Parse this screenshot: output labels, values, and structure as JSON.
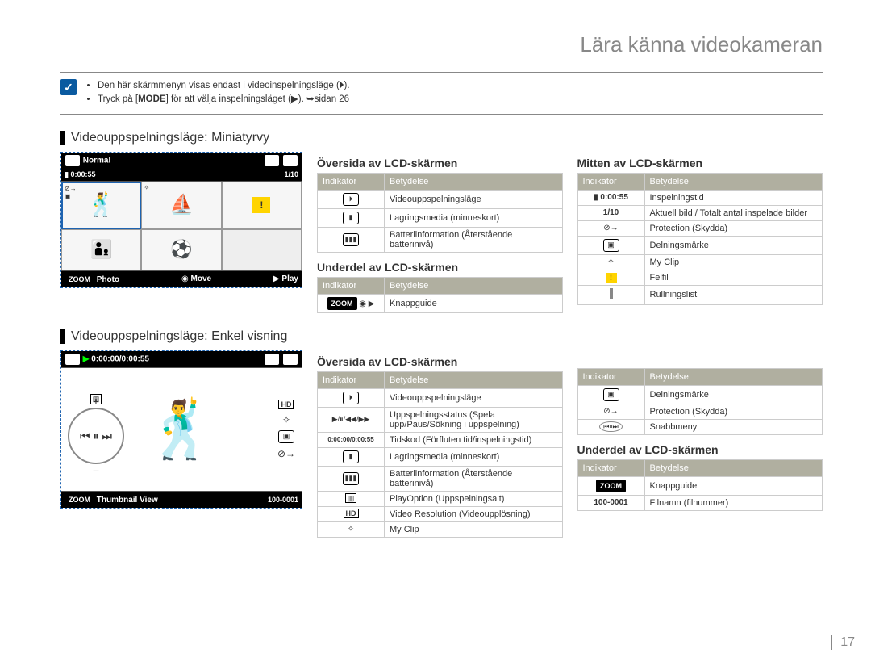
{
  "page": {
    "title": "Lära känna videokameran",
    "number": "17"
  },
  "notes": {
    "bullet1": "Den här skärmmenyn visas endast i videoinspelningsläge (⏵).",
    "bullet2_a": "Tryck på [",
    "bullet2_mode": "MODE",
    "bullet2_b": "] för att välja inspelningsläget (▶). ➥sidan 26"
  },
  "sections": {
    "s1": "Videouppspelningsläge: Miniatyrvy",
    "s2": "Videouppspelningsläge: Enkel visning"
  },
  "lcd1": {
    "topLeft": "Normal",
    "subLeft": "0:00:55",
    "subRight": "1/10",
    "botPhoto": "Photo",
    "botMove": "Move",
    "botPlay": "Play",
    "zoom": "ZOOM"
  },
  "lcd2": {
    "play": "▶",
    "time": "0:00:00/0:00:55",
    "bottomLeft": "Thumbnail View",
    "bottomRight": "100-0001",
    "zoom": "ZOOM"
  },
  "headers": {
    "top": "Översida av LCD-skärmen",
    "mid": "Mitten av LCD-skärmen",
    "bottom": "Underdel av LCD-skärmen",
    "ind": "Indikator",
    "mean": "Betydelse"
  },
  "table_top1": [
    {
      "i": "⏵",
      "m": "Videouppspelningsläge"
    },
    {
      "i": "▮",
      "m": "Lagringsmedia (minneskort)"
    },
    {
      "i": "▮▮▮",
      "m": "Batteriinformation (Återstående batterinivå)"
    }
  ],
  "table_bottom1": [
    {
      "i": "ZOOM ◉ ▶",
      "m": "Knappguide"
    }
  ],
  "table_mid1": [
    {
      "i": "▮ 0:00:55",
      "m": "Inspelningstid"
    },
    {
      "i": "1/10",
      "m": "Aktuell bild / Totalt antal inspelade bilder"
    },
    {
      "i": "⊘→",
      "m": "Protection (Skydda)"
    },
    {
      "i": "▣",
      "m": "Delningsmärke"
    },
    {
      "i": "✧",
      "m": "My Clip"
    },
    {
      "i": "⚠",
      "m": "Felfil"
    },
    {
      "i": "",
      "m": "Rullningslist"
    }
  ],
  "table_top2": [
    {
      "i": "⏵",
      "m": "Videouppspelningsläge"
    },
    {
      "i": "▶/⏸/◀◀/▶▶",
      "m": "Uppspelningsstatus (Spela upp/Paus/Sökning i uppspelning)"
    },
    {
      "i": "0:00:00/0:00:55",
      "m": "Tidskod (Förfluten tid/inspelningstid)"
    },
    {
      "i": "▮",
      "m": "Lagringsmedia (minneskort)"
    },
    {
      "i": "▮▮▮",
      "m": "Batteriinformation (Återstående batterinivå)"
    },
    {
      "i": "▥",
      "m": "PlayOption (Uppspelningsalt)"
    },
    {
      "i": "HD",
      "m": "Video Resolution (Videoupplösning)"
    },
    {
      "i": "✧",
      "m": "My Clip"
    }
  ],
  "table_right2a": [
    {
      "i": "▣",
      "m": "Delningsmärke"
    },
    {
      "i": "⊘→",
      "m": "Protection (Skydda)"
    },
    {
      "i": "◉⏸◉",
      "m": "Snabbmeny"
    }
  ],
  "table_right2b": [
    {
      "i": "ZOOM",
      "m": "Knappguide"
    },
    {
      "i": "100-0001",
      "m": "Filnamn (filnummer)"
    }
  ]
}
